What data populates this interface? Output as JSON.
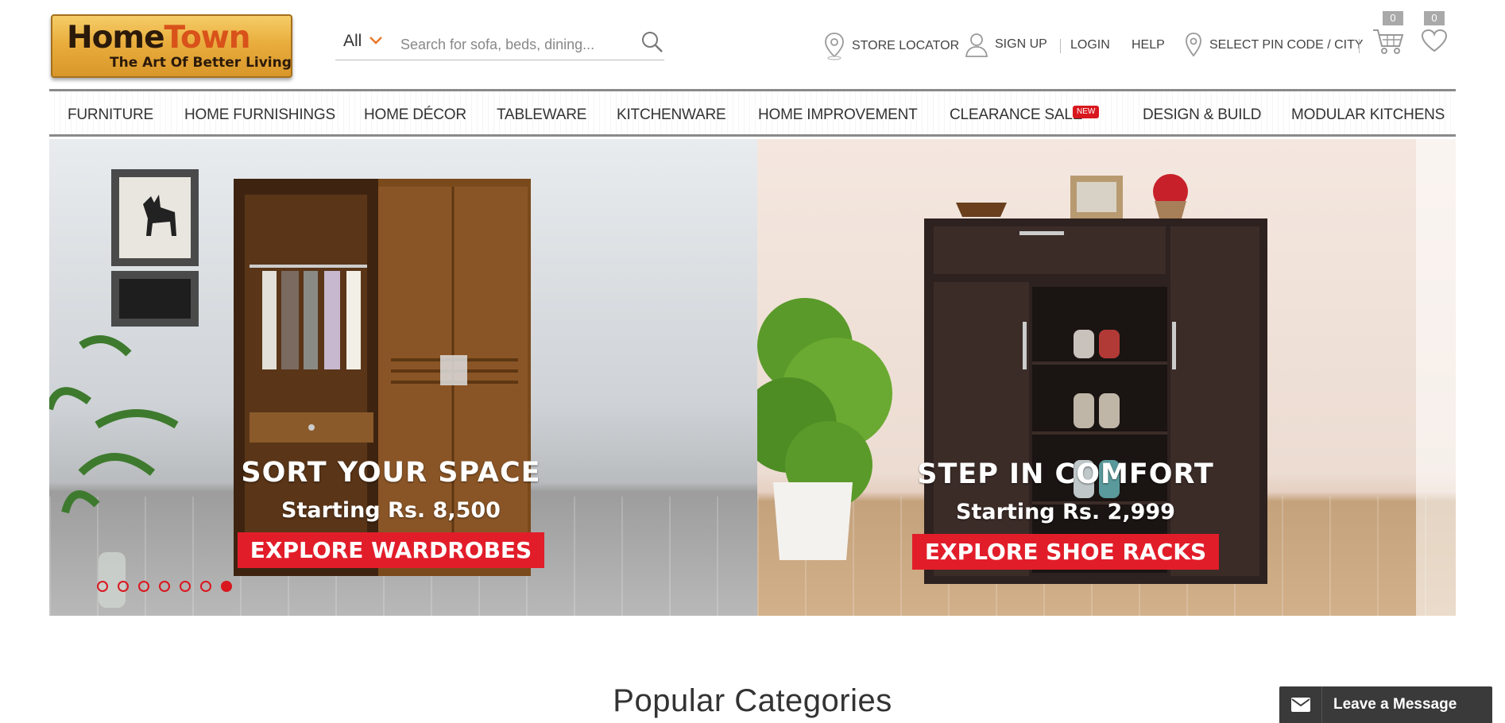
{
  "brand": {
    "logo_home": "Home",
    "logo_town": "Town",
    "tagline": "The Art Of Better Living"
  },
  "search": {
    "category": "All",
    "placeholder": "Search for sofa, beds, dining..."
  },
  "header_links": {
    "store_locator": "STORE LOCATOR",
    "sign_up": "SIGN UP",
    "login": "LOGIN",
    "help": "HELP",
    "pincode": "SELECT PIN CODE / CITY",
    "cart_count": "0",
    "wishlist_count": "0"
  },
  "nav": {
    "items": [
      "FURNITURE",
      "HOME FURNISHINGS",
      "HOME DÉCOR",
      "TABLEWARE",
      "KITCHENWARE",
      "HOME IMPROVEMENT",
      "CLEARANCE SALE",
      "DESIGN & BUILD",
      "MODULAR KITCHENS"
    ],
    "new_badge": "NEW"
  },
  "banners": [
    {
      "title": "SORT YOUR SPACE",
      "subtitle": "Starting Rs. 8,500",
      "cta": "EXPLORE WARDROBES"
    },
    {
      "title": "STEP IN COMFORT",
      "subtitle": "Starting Rs. 2,999",
      "cta": "EXPLORE SHOE RACKS"
    }
  ],
  "carousel": {
    "total": 7,
    "active_index": 6
  },
  "section": {
    "title": "Popular Categories"
  },
  "chat": {
    "label": "Leave a Message"
  },
  "colors": {
    "accent_red": "#e21d2a",
    "search_chevron": "#e8792b",
    "chat_bg": "#3a3a3a"
  },
  "icons": {
    "search": "search-icon",
    "store_locator": "location-pin-icon",
    "sign_up": "user-icon",
    "pincode": "location-pin-icon",
    "cart": "cart-icon",
    "wishlist": "heart-icon",
    "chat": "envelope-icon"
  }
}
